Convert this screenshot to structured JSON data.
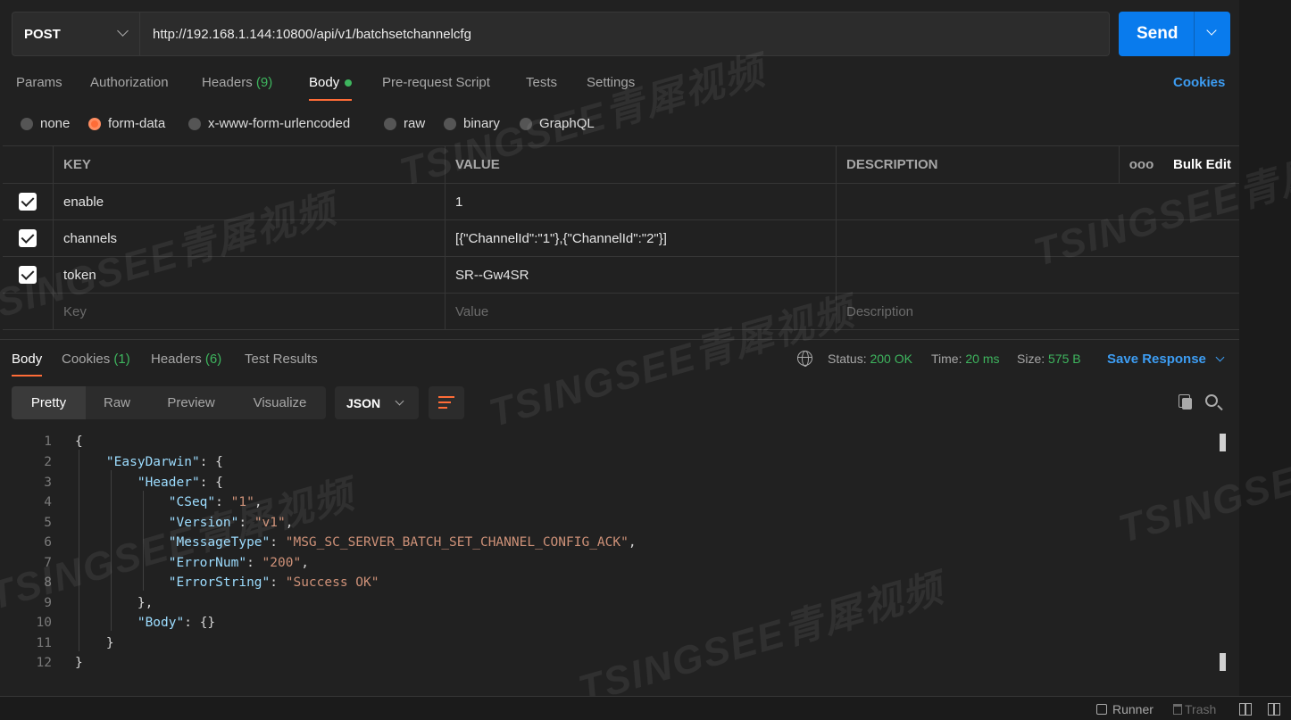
{
  "request": {
    "method": "POST",
    "url": "http://192.168.1.144:10800/api/v1/batchsetchannelcfg",
    "send_label": "Send"
  },
  "req_tabs": {
    "params": "Params",
    "authorization": "Authorization",
    "headers": "Headers",
    "headers_count": "(9)",
    "body": "Body",
    "prerequest": "Pre-request Script",
    "tests": "Tests",
    "settings": "Settings",
    "cookies": "Cookies"
  },
  "body_types": [
    "none",
    "form-data",
    "x-www-form-urlencoded",
    "raw",
    "binary",
    "GraphQL"
  ],
  "params_table": {
    "headers": {
      "key": "KEY",
      "value": "VALUE",
      "description": "DESCRIPTION",
      "more": "ooo",
      "bulk_edit": "Bulk Edit"
    },
    "rows": [
      {
        "key": "enable",
        "value": "1",
        "description": "",
        "checked": true
      },
      {
        "key": "channels",
        "value": "[{\"ChannelId\":\"1\"},{\"ChannelId\":\"2\"}]",
        "description": "",
        "checked": true
      },
      {
        "key": "token",
        "value": "SR--Gw4SR",
        "description": "",
        "checked": true
      }
    ],
    "placeholders": {
      "key": "Key",
      "value": "Value",
      "description": "Description"
    }
  },
  "response": {
    "tabs": {
      "body": "Body",
      "cookies": "Cookies",
      "cookies_count": "(1)",
      "headers": "Headers",
      "headers_count": "(6)",
      "test_results": "Test Results"
    },
    "status_label": "Status:",
    "status_value": "200 OK",
    "time_label": "Time:",
    "time_value": "20 ms",
    "size_label": "Size:",
    "size_value": "575 B",
    "save_response": "Save Response",
    "view_modes": [
      "Pretty",
      "Raw",
      "Preview",
      "Visualize"
    ],
    "format": "JSON"
  },
  "code_lines": [
    "1",
    "2",
    "3",
    "4",
    "5",
    "6",
    "7",
    "8",
    "9",
    "10",
    "11",
    "12"
  ],
  "footer": {
    "runner": "Runner",
    "trash": "Trash"
  },
  "watermark": "TSINGSEE青犀视频",
  "colors": {
    "accent": "#ff6c37",
    "send": "#097bed",
    "link": "#3d9df3",
    "success": "#3eb55e"
  }
}
